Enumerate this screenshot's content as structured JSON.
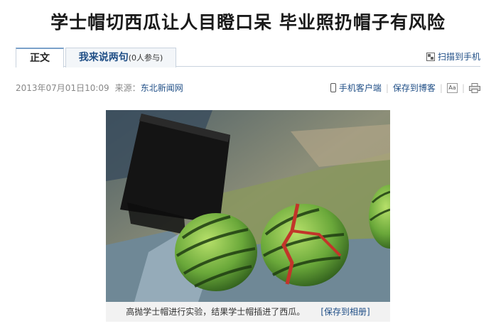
{
  "article": {
    "title": "学士帽切西瓜让人目瞪口呆  毕业照扔帽子有风险"
  },
  "tabs": {
    "main_label": "正文",
    "comment_label": "我来说两句",
    "comment_count": "(0人参与)"
  },
  "scan_to_phone": {
    "label": "扫描到手机",
    "icon": "qr-code-icon"
  },
  "meta": {
    "datetime": "2013年07月01日10:09",
    "source_label": "来源：",
    "source_name": "东北新闻网"
  },
  "tools": {
    "mobile_client": "手机客户端",
    "save_to_blog": "保存到博客",
    "font_icon_text": "Aa",
    "icons": [
      "phone-icon",
      "font-size-icon",
      "print-icon"
    ]
  },
  "photo": {
    "caption": "高抛学士帽进行实验，结果学士帽插进了西瓜。",
    "save_to_album": "[保存到相册]"
  },
  "colors": {
    "link": "#1f4e86",
    "tab_border": "#c9d3de",
    "caption_bg": "#f2f2f2"
  }
}
